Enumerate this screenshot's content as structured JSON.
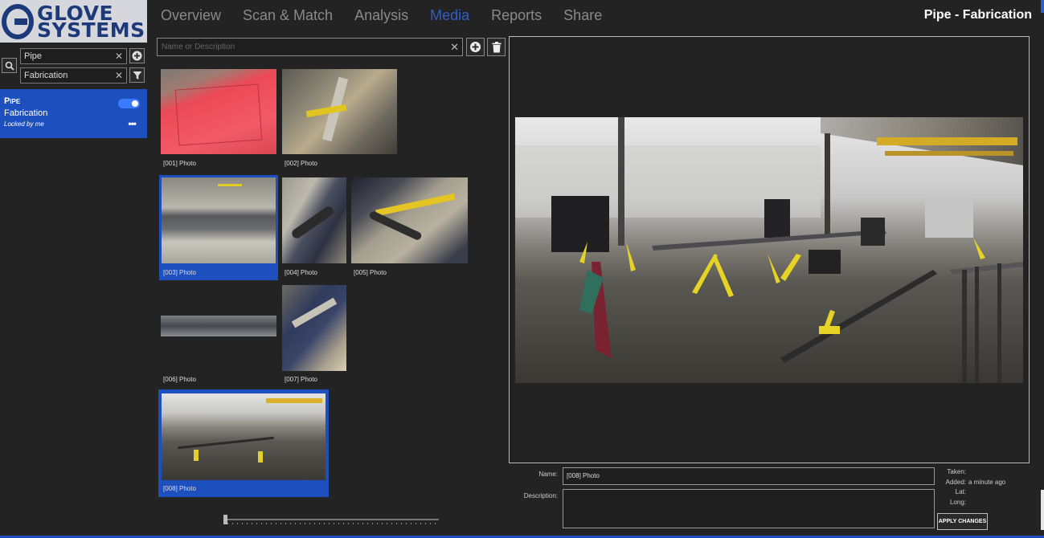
{
  "brand": {
    "line1": "GLOVE",
    "line2": "SYSTEMS"
  },
  "nav": {
    "tabs": [
      {
        "label": "Overview"
      },
      {
        "label": "Scan & Match"
      },
      {
        "label": "Analysis"
      },
      {
        "label": "Media"
      },
      {
        "label": "Reports"
      },
      {
        "label": "Share"
      }
    ],
    "active": "Media"
  },
  "page_title": "Pipe - Fabrication",
  "sidebar": {
    "filters": [
      {
        "value": "Pipe"
      },
      {
        "value": "Fabrication"
      }
    ],
    "project": {
      "title": "Pipe",
      "subtitle": "Fabrication",
      "lock_status": "Locked by me",
      "more": "•••"
    }
  },
  "media_search": {
    "placeholder": "Name or Description",
    "value": ""
  },
  "thumbnails": [
    {
      "label": "[001] Photo"
    },
    {
      "label": "[002] Photo"
    },
    {
      "label": "[003] Photo"
    },
    {
      "label": "[004] Photo"
    },
    {
      "label": "[005] Photo"
    },
    {
      "label": "[006] Photo"
    },
    {
      "label": "[007] Photo"
    },
    {
      "label": "[008] Photo"
    }
  ],
  "details": {
    "name_label": "Name:",
    "name_value": "[008] Photo",
    "description_label": "Description:",
    "description_value": "",
    "taken_label": "Taken:",
    "taken_value": "",
    "added_label": "Added:",
    "added_value": "a minute ago",
    "lat_label": "Lat:",
    "lat_value": "",
    "long_label": "Long:",
    "long_value": "",
    "apply_label": "APPLY CHANGES"
  },
  "colors": {
    "accent": "#1e4fbf",
    "background": "#232323",
    "active_tab": "#2f5ec9"
  }
}
